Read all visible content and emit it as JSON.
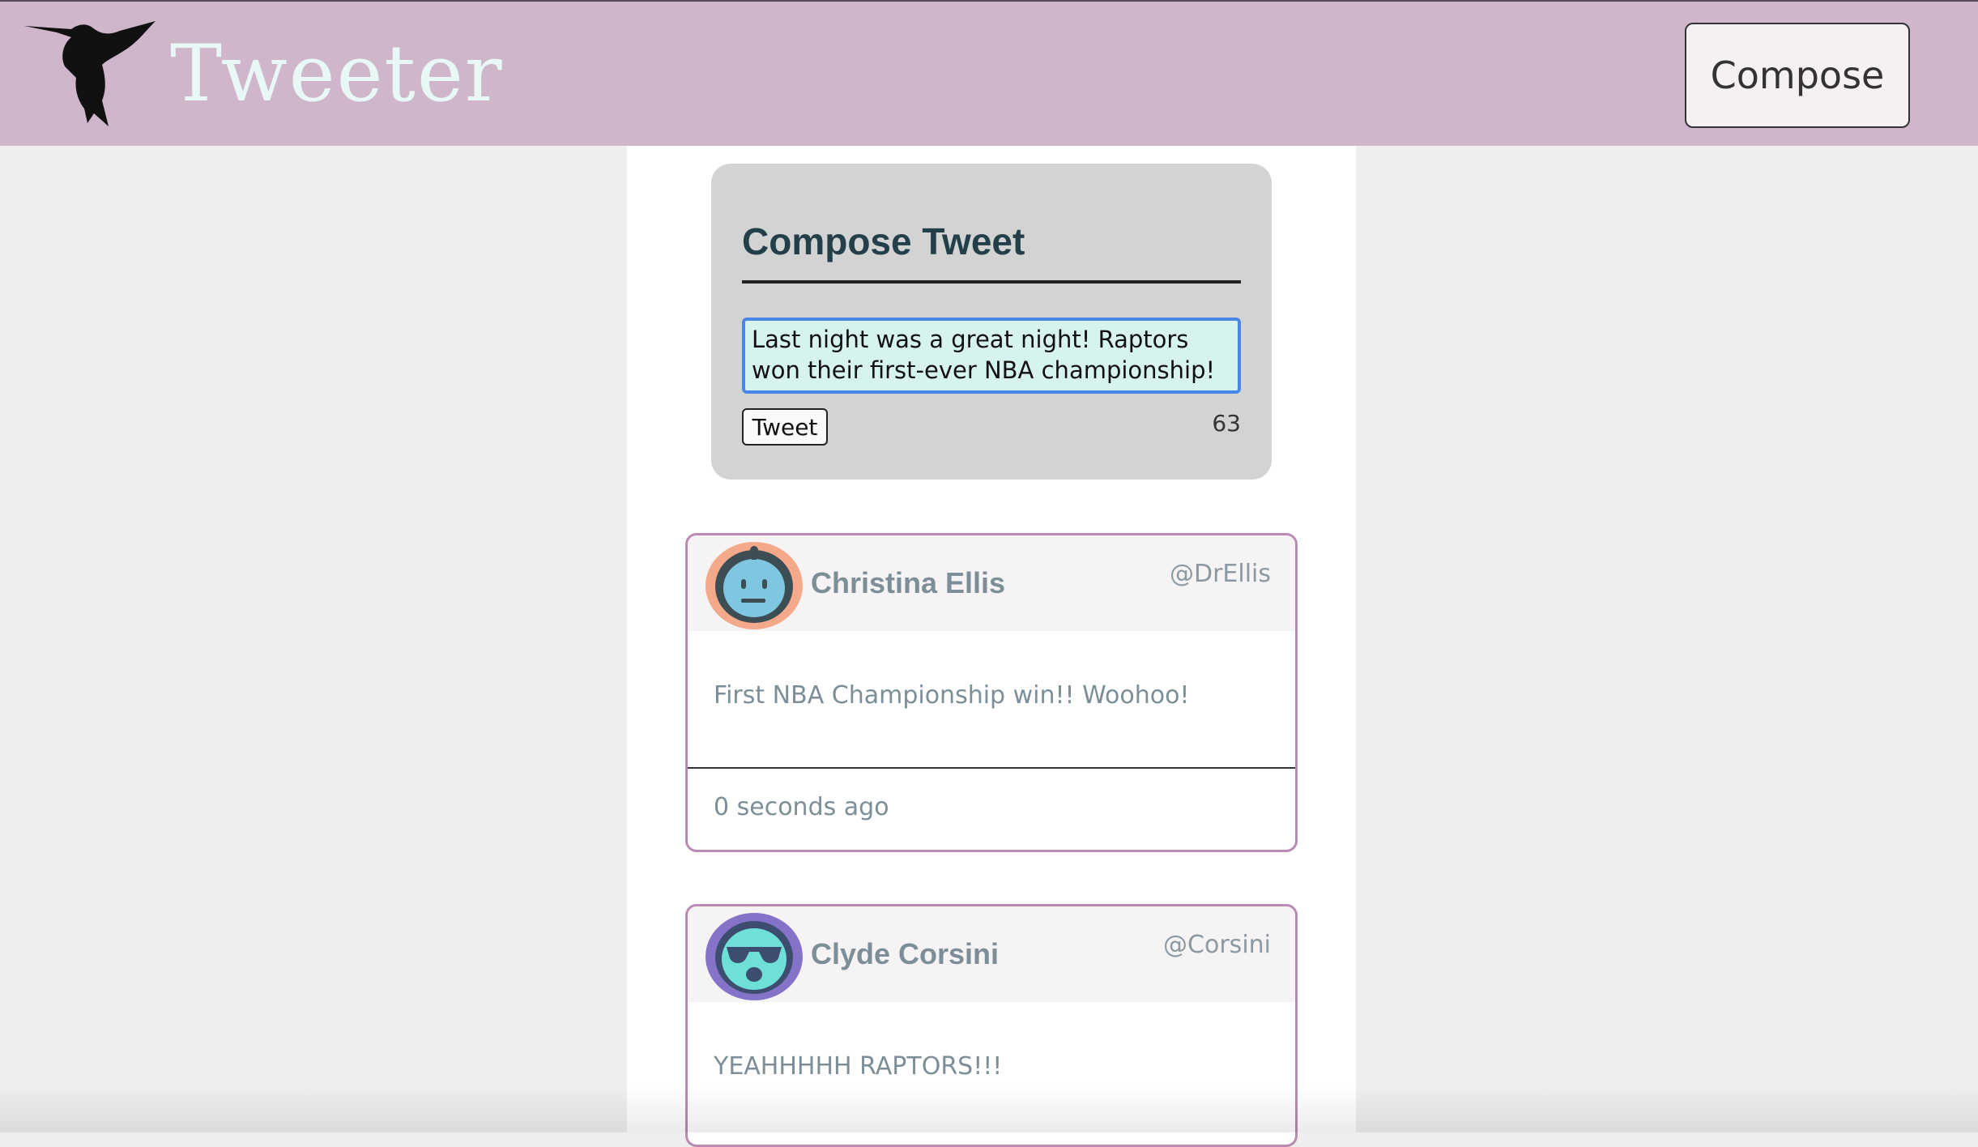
{
  "header": {
    "logo_icon": "hummingbird-icon",
    "app_name": "Tweeter",
    "compose_label": "Compose",
    "colors": {
      "bar": "#cfb6cb",
      "logo_text": "#e8f8f6"
    }
  },
  "compose": {
    "title": "Compose Tweet",
    "text_value": "Last night was a great night! Raptors won their first-ever NBA championship!",
    "submit_label": "Tweet",
    "char_counter": "63",
    "colors": {
      "box_bg": "#d3d3d3",
      "input_bg": "#d6f3f0",
      "input_focus_border": "#4a86e6"
    }
  },
  "tweets": [
    {
      "avatar_icon": "robot-face-avatar-icon",
      "name": "Christina Ellis",
      "handle": "@DrEllis",
      "content": "First NBA Championship win!! Woohoo!",
      "time": "0 seconds ago"
    },
    {
      "avatar_icon": "sunglasses-face-avatar-icon",
      "name": "Clyde Corsini",
      "handle": "@Corsini",
      "content": "YEAHHHHH RAPTORS!!!"
    }
  ],
  "card_border_color": "#b98ab2"
}
